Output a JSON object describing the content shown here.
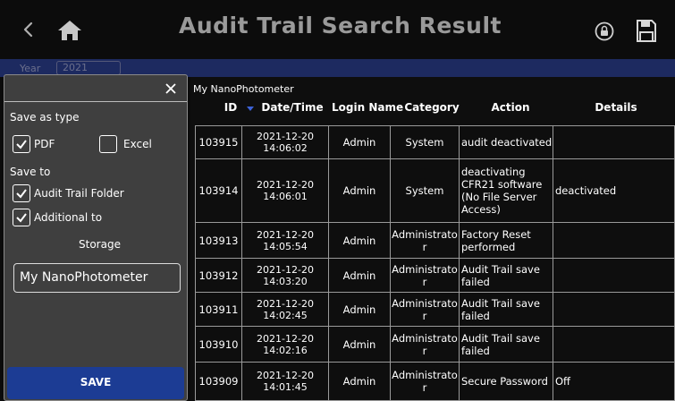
{
  "header": {
    "title": "Audit Trail Search Result",
    "icons": [
      "chevron-left-icon",
      "home-icon",
      "lock-icon",
      "save-disk-icon"
    ]
  },
  "filter": {
    "year_label": "Year",
    "year_value": "2021"
  },
  "panel": {
    "save_as_type_label": "Save as type",
    "pdf_label": "PDF",
    "pdf_checked": true,
    "excel_label": "Excel",
    "excel_checked": false,
    "save_to_label": "Save to",
    "audit_folder_label": "Audit Trail Folder",
    "audit_folder_checked": true,
    "additional_label": "Additional to",
    "additional_checked": true,
    "storage_label": "Storage",
    "filename_value": "My NanoPhotometer",
    "save_button": "SAVE"
  },
  "table": {
    "title": "My NanoPhotometer",
    "columns": [
      "ID",
      "Date/Time",
      "Login Name",
      "Category",
      "Action",
      "Details"
    ],
    "rows": [
      {
        "id": "103915",
        "date": "2021-12-20",
        "time": "14:06:02",
        "login": "Admin",
        "category": "System",
        "action": "audit deactivated",
        "details": ""
      },
      {
        "id": "103914",
        "date": "2021-12-20",
        "time": "14:06:01",
        "login": "Admin",
        "category": "System",
        "action": "deactivating CFR21 software (No File Server Access)",
        "details": "deactivated"
      },
      {
        "id": "103913",
        "date": "2021-12-20",
        "time": "14:05:54",
        "login": "Admin",
        "category": "Administrator",
        "action": "Factory Reset performed",
        "details": ""
      },
      {
        "id": "103912",
        "date": "2021-12-20",
        "time": "14:03:20",
        "login": "Admin",
        "category": "Administrator",
        "action": "Audit Trail save failed",
        "details": ""
      },
      {
        "id": "103911",
        "date": "2021-12-20",
        "time": "14:02:45",
        "login": "Admin",
        "category": "Administrator",
        "action": "Audit Trail save failed",
        "details": ""
      },
      {
        "id": "103910",
        "date": "2021-12-20",
        "time": "14:02:16",
        "login": "Admin",
        "category": "Administrator",
        "action": "Audit Trail save failed",
        "details": ""
      },
      {
        "id": "103909",
        "date": "2021-12-20",
        "time": "14:01:45",
        "login": "Admin",
        "category": "Administrator",
        "action": "Secure Password",
        "details": "Off"
      }
    ]
  },
  "colors": {
    "header_bg": "#0c0c0c",
    "title_gray": "#9a9a9a",
    "strip_blue": "#1d2a60",
    "panel_bg": "#3f3f3f",
    "save_blue": "#1c3c94",
    "sort_arrow": "#3d63d8"
  }
}
